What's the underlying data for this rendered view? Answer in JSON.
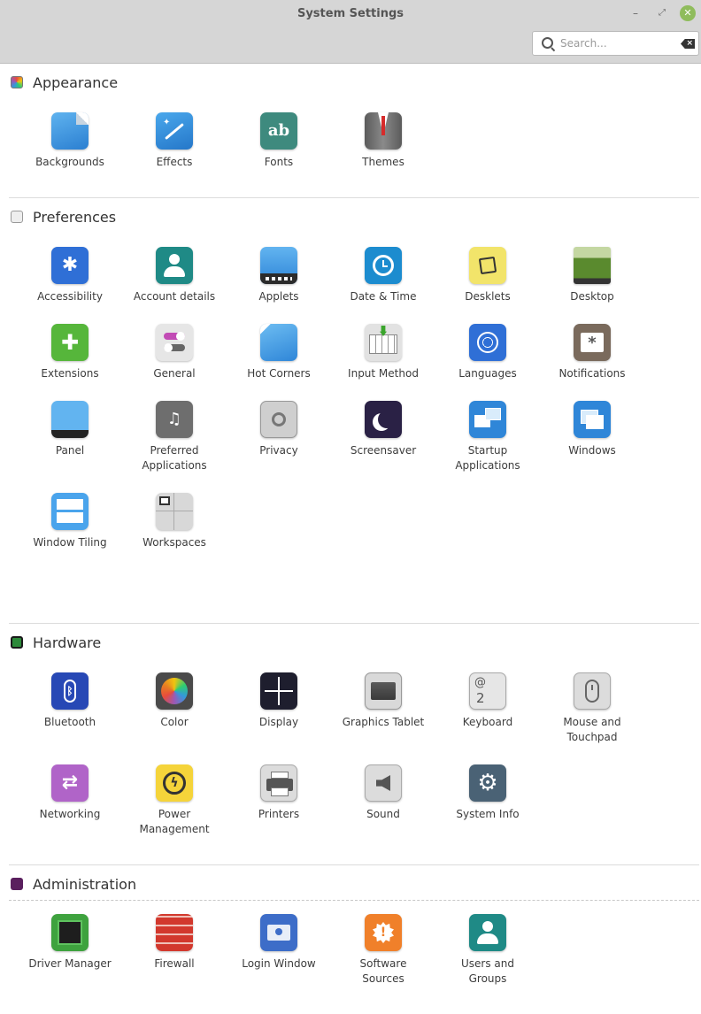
{
  "window": {
    "title": "System Settings",
    "minimize_glyph": "–",
    "maximize_glyph": "⤢",
    "close_glyph": "✕"
  },
  "search": {
    "placeholder": "Search...",
    "value": ""
  },
  "sections": {
    "appearance": {
      "title": "Appearance",
      "items": [
        {
          "label": "Backgrounds",
          "icon": "backgrounds-icon"
        },
        {
          "label": "Effects",
          "icon": "effects-icon"
        },
        {
          "label": "Fonts",
          "icon": "fonts-icon"
        },
        {
          "label": "Themes",
          "icon": "themes-icon"
        }
      ]
    },
    "preferences": {
      "title": "Preferences",
      "items": [
        {
          "label": "Accessibility",
          "icon": "accessibility-icon"
        },
        {
          "label": "Account details",
          "icon": "account-details-icon"
        },
        {
          "label": "Applets",
          "icon": "applets-icon"
        },
        {
          "label": "Date & Time",
          "icon": "clock-icon"
        },
        {
          "label": "Desklets",
          "icon": "desklets-icon"
        },
        {
          "label": "Desktop",
          "icon": "desktop-icon"
        },
        {
          "label": "Extensions",
          "icon": "puzzle-icon"
        },
        {
          "label": "General",
          "icon": "toggle-icon"
        },
        {
          "label": "Hot Corners",
          "icon": "hot-corners-icon"
        },
        {
          "label": "Input Method",
          "icon": "keyboard-input-icon"
        },
        {
          "label": "Languages",
          "icon": "globe-icon"
        },
        {
          "label": "Notifications",
          "icon": "notification-icon"
        },
        {
          "label": "Panel",
          "icon": "panel-icon"
        },
        {
          "label": "Preferred\nApplications",
          "icon": "preferred-apps-icon"
        },
        {
          "label": "Privacy",
          "icon": "safe-icon"
        },
        {
          "label": "Screensaver",
          "icon": "moon-icon"
        },
        {
          "label": "Startup\nApplications",
          "icon": "startup-icon"
        },
        {
          "label": "Windows",
          "icon": "windows-icon"
        },
        {
          "label": "Window Tiling",
          "icon": "window-tiling-icon"
        },
        {
          "label": "Workspaces",
          "icon": "workspaces-icon"
        }
      ]
    },
    "hardware": {
      "title": "Hardware",
      "items": [
        {
          "label": "Bluetooth",
          "icon": "bluetooth-icon"
        },
        {
          "label": "Color",
          "icon": "color-icon"
        },
        {
          "label": "Display",
          "icon": "display-icon"
        },
        {
          "label": "Graphics Tablet",
          "icon": "tablet-icon"
        },
        {
          "label": "Keyboard",
          "icon": "keyboard-icon"
        },
        {
          "label": "Mouse and\nTouchpad",
          "icon": "mouse-icon"
        },
        {
          "label": "Networking",
          "icon": "network-arrows-icon"
        },
        {
          "label": "Power\nManagement",
          "icon": "power-icon"
        },
        {
          "label": "Printers",
          "icon": "printer-icon"
        },
        {
          "label": "Sound",
          "icon": "speaker-icon"
        },
        {
          "label": "System Info",
          "icon": "gear-icon"
        }
      ]
    },
    "administration": {
      "title": "Administration",
      "items": [
        {
          "label": "Driver Manager",
          "icon": "chip-icon"
        },
        {
          "label": "Firewall",
          "icon": "brick-wall-icon"
        },
        {
          "label": "Login Window",
          "icon": "login-window-icon"
        },
        {
          "label": "Software\nSources",
          "icon": "software-sources-icon"
        },
        {
          "label": "Users and\nGroups",
          "icon": "users-icon"
        }
      ]
    }
  },
  "glyphs": {
    "fonts": "ab",
    "keyboard_at": "@",
    "keyboard_2": "2",
    "notification": "*"
  }
}
